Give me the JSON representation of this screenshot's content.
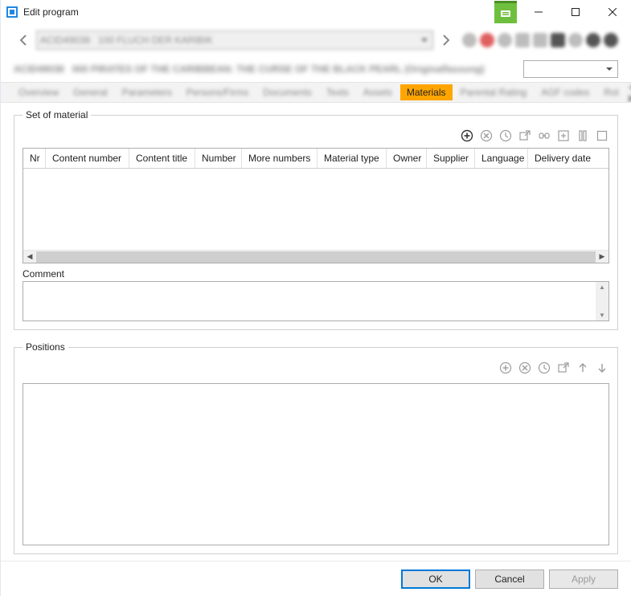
{
  "window": {
    "title": "Edit program"
  },
  "tabs": {
    "items": [
      "Overview",
      "General",
      "Parameters",
      "Persons/Firms",
      "Documents",
      "Texts",
      "Assets",
      "Materials",
      "Parental Rating",
      "AGF codes",
      "Rot"
    ],
    "active_index": 7
  },
  "setOfMaterial": {
    "legend": "Set of material",
    "columns": [
      "Nr",
      "Content number",
      "Content title",
      "Number",
      "More numbers",
      "Material type",
      "Owner",
      "Supplier",
      "Language",
      "Delivery date"
    ],
    "rows": []
  },
  "comment": {
    "label": "Comment",
    "value": ""
  },
  "positions": {
    "legend": "Positions"
  },
  "footer": {
    "ok": "OK",
    "cancel": "Cancel",
    "apply": "Apply"
  }
}
